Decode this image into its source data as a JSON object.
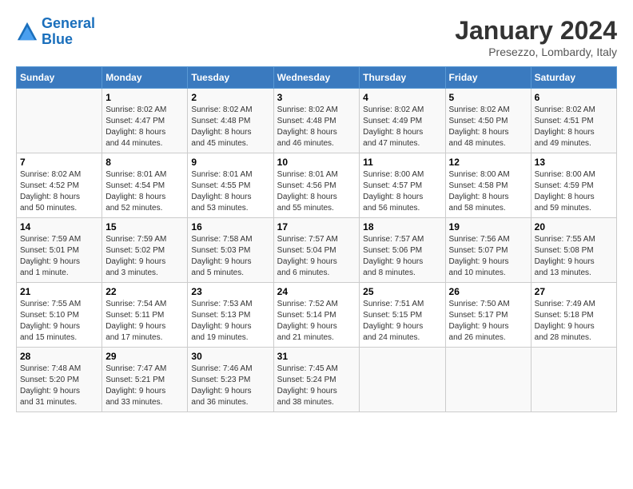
{
  "logo": {
    "general": "General",
    "blue": "Blue"
  },
  "header": {
    "month": "January 2024",
    "location": "Presezzo, Lombardy, Italy"
  },
  "weekdays": [
    "Sunday",
    "Monday",
    "Tuesday",
    "Wednesday",
    "Thursday",
    "Friday",
    "Saturday"
  ],
  "weeks": [
    [
      {
        "day": "",
        "info": ""
      },
      {
        "day": "1",
        "info": "Sunrise: 8:02 AM\nSunset: 4:47 PM\nDaylight: 8 hours\nand 44 minutes."
      },
      {
        "day": "2",
        "info": "Sunrise: 8:02 AM\nSunset: 4:48 PM\nDaylight: 8 hours\nand 45 minutes."
      },
      {
        "day": "3",
        "info": "Sunrise: 8:02 AM\nSunset: 4:48 PM\nDaylight: 8 hours\nand 46 minutes."
      },
      {
        "day": "4",
        "info": "Sunrise: 8:02 AM\nSunset: 4:49 PM\nDaylight: 8 hours\nand 47 minutes."
      },
      {
        "day": "5",
        "info": "Sunrise: 8:02 AM\nSunset: 4:50 PM\nDaylight: 8 hours\nand 48 minutes."
      },
      {
        "day": "6",
        "info": "Sunrise: 8:02 AM\nSunset: 4:51 PM\nDaylight: 8 hours\nand 49 minutes."
      }
    ],
    [
      {
        "day": "7",
        "info": "Sunrise: 8:02 AM\nSunset: 4:52 PM\nDaylight: 8 hours\nand 50 minutes."
      },
      {
        "day": "8",
        "info": "Sunrise: 8:01 AM\nSunset: 4:54 PM\nDaylight: 8 hours\nand 52 minutes."
      },
      {
        "day": "9",
        "info": "Sunrise: 8:01 AM\nSunset: 4:55 PM\nDaylight: 8 hours\nand 53 minutes."
      },
      {
        "day": "10",
        "info": "Sunrise: 8:01 AM\nSunset: 4:56 PM\nDaylight: 8 hours\nand 55 minutes."
      },
      {
        "day": "11",
        "info": "Sunrise: 8:00 AM\nSunset: 4:57 PM\nDaylight: 8 hours\nand 56 minutes."
      },
      {
        "day": "12",
        "info": "Sunrise: 8:00 AM\nSunset: 4:58 PM\nDaylight: 8 hours\nand 58 minutes."
      },
      {
        "day": "13",
        "info": "Sunrise: 8:00 AM\nSunset: 4:59 PM\nDaylight: 8 hours\nand 59 minutes."
      }
    ],
    [
      {
        "day": "14",
        "info": "Sunrise: 7:59 AM\nSunset: 5:01 PM\nDaylight: 9 hours\nand 1 minute."
      },
      {
        "day": "15",
        "info": "Sunrise: 7:59 AM\nSunset: 5:02 PM\nDaylight: 9 hours\nand 3 minutes."
      },
      {
        "day": "16",
        "info": "Sunrise: 7:58 AM\nSunset: 5:03 PM\nDaylight: 9 hours\nand 5 minutes."
      },
      {
        "day": "17",
        "info": "Sunrise: 7:57 AM\nSunset: 5:04 PM\nDaylight: 9 hours\nand 6 minutes."
      },
      {
        "day": "18",
        "info": "Sunrise: 7:57 AM\nSunset: 5:06 PM\nDaylight: 9 hours\nand 8 minutes."
      },
      {
        "day": "19",
        "info": "Sunrise: 7:56 AM\nSunset: 5:07 PM\nDaylight: 9 hours\nand 10 minutes."
      },
      {
        "day": "20",
        "info": "Sunrise: 7:55 AM\nSunset: 5:08 PM\nDaylight: 9 hours\nand 13 minutes."
      }
    ],
    [
      {
        "day": "21",
        "info": "Sunrise: 7:55 AM\nSunset: 5:10 PM\nDaylight: 9 hours\nand 15 minutes."
      },
      {
        "day": "22",
        "info": "Sunrise: 7:54 AM\nSunset: 5:11 PM\nDaylight: 9 hours\nand 17 minutes."
      },
      {
        "day": "23",
        "info": "Sunrise: 7:53 AM\nSunset: 5:13 PM\nDaylight: 9 hours\nand 19 minutes."
      },
      {
        "day": "24",
        "info": "Sunrise: 7:52 AM\nSunset: 5:14 PM\nDaylight: 9 hours\nand 21 minutes."
      },
      {
        "day": "25",
        "info": "Sunrise: 7:51 AM\nSunset: 5:15 PM\nDaylight: 9 hours\nand 24 minutes."
      },
      {
        "day": "26",
        "info": "Sunrise: 7:50 AM\nSunset: 5:17 PM\nDaylight: 9 hours\nand 26 minutes."
      },
      {
        "day": "27",
        "info": "Sunrise: 7:49 AM\nSunset: 5:18 PM\nDaylight: 9 hours\nand 28 minutes."
      }
    ],
    [
      {
        "day": "28",
        "info": "Sunrise: 7:48 AM\nSunset: 5:20 PM\nDaylight: 9 hours\nand 31 minutes."
      },
      {
        "day": "29",
        "info": "Sunrise: 7:47 AM\nSunset: 5:21 PM\nDaylight: 9 hours\nand 33 minutes."
      },
      {
        "day": "30",
        "info": "Sunrise: 7:46 AM\nSunset: 5:23 PM\nDaylight: 9 hours\nand 36 minutes."
      },
      {
        "day": "31",
        "info": "Sunrise: 7:45 AM\nSunset: 5:24 PM\nDaylight: 9 hours\nand 38 minutes."
      },
      {
        "day": "",
        "info": ""
      },
      {
        "day": "",
        "info": ""
      },
      {
        "day": "",
        "info": ""
      }
    ]
  ]
}
